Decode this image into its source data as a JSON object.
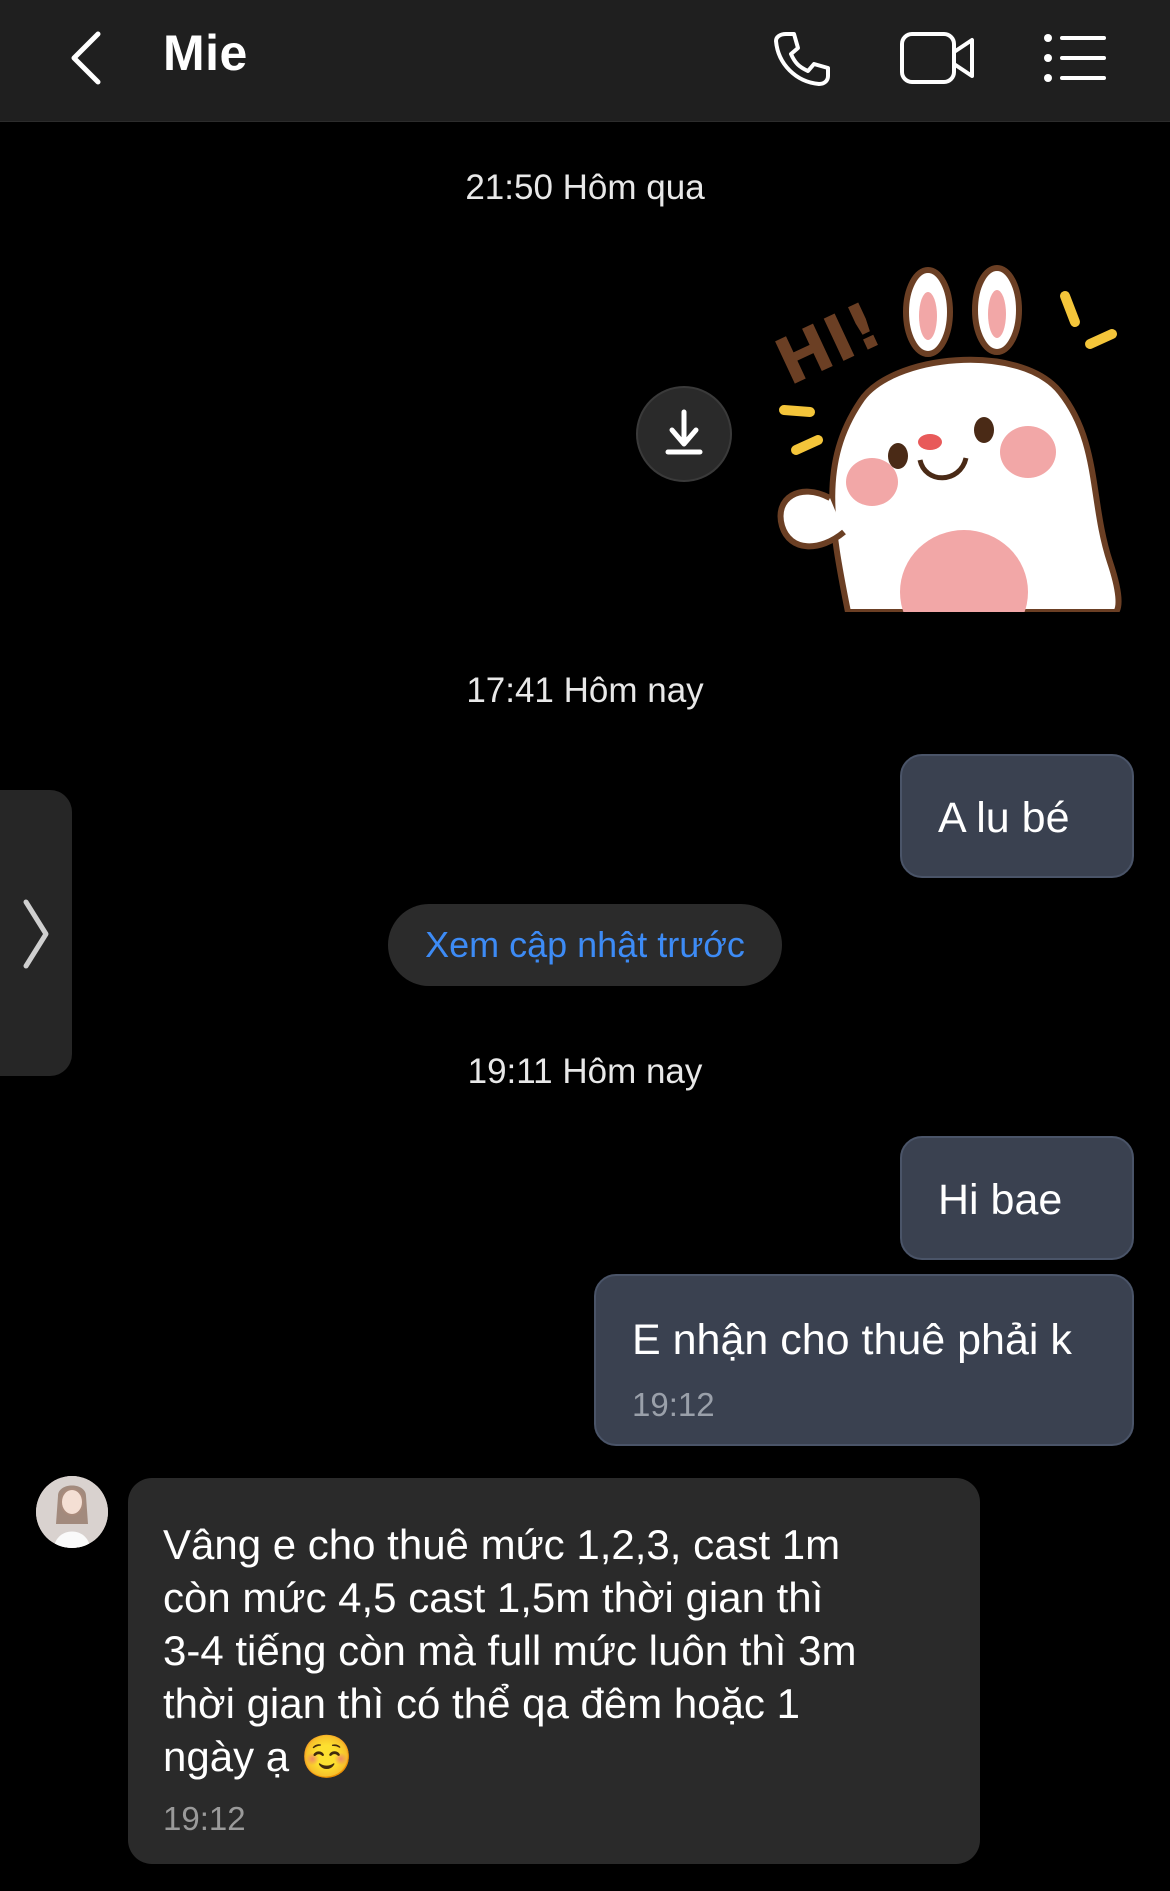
{
  "header": {
    "title": "Mie"
  },
  "timestamps": {
    "yesterday": "21:50 Hôm qua",
    "today1": "17:41 Hôm nay",
    "today2": "19:11 Hôm nay"
  },
  "sticker": {
    "text": "HI!"
  },
  "messages": {
    "out1": {
      "text": "A lu bé"
    },
    "out2": {
      "text": "Hi bae"
    },
    "out3": {
      "text": "E nhận cho thuê phải k",
      "time": "19:12"
    },
    "in1": {
      "lines": [
        "Vâng e cho thuê mức 1,2,3, cast 1m",
        "còn mức 4,5 cast 1,5m  thời gian thì",
        "3-4 tiếng còn mà full mức luôn thì 3m",
        "thời gian thì có thể qa đêm hoặc 1",
        "ngày ạ"
      ],
      "emoji": "☺️",
      "time": "19:12"
    }
  },
  "update_button": {
    "label": "Xem cập nhật trước"
  },
  "icons": {
    "back": "chevron-left-icon",
    "call": "phone-icon",
    "video": "video-icon",
    "menu": "list-menu-icon",
    "download": "download-icon",
    "side": "chevron-right-icon"
  },
  "colors": {
    "background": "#000000",
    "header": "#1f1f1f",
    "outgoing_bubble": "#3a4150",
    "incoming_bubble": "#2a2a2a",
    "link": "#3d8bf5"
  }
}
